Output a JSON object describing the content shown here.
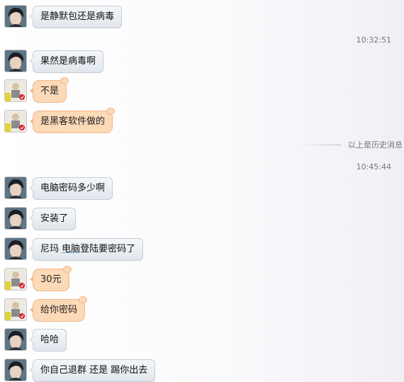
{
  "messages_before": [
    {
      "text": "是静默包还是病毒",
      "sender": "friend"
    }
  ],
  "time_1": "10:32:51",
  "block_1": [
    {
      "text": "果然是病毒啊",
      "sender": "friend"
    },
    {
      "text": "不是",
      "sender": "me"
    },
    {
      "text": "是黑客软件做的",
      "sender": "me"
    }
  ],
  "history_label": "以上是历史消息",
  "time_2": "10:45:44",
  "block_2": [
    {
      "text": "电脑密码多少啊",
      "sender": "friend"
    },
    {
      "text": "安装了",
      "sender": "friend"
    },
    {
      "text_a": "尼玛 ",
      "text_b": "电脑",
      "text_c": "登陆要密码了",
      "sender": "friend"
    },
    {
      "text": "30元",
      "sender": "me"
    },
    {
      "text": "给你密码",
      "sender": "me"
    },
    {
      "text": "哈哈",
      "sender": "friend"
    },
    {
      "text": "你自己退群 还是 踢你出去",
      "sender": "friend"
    }
  ],
  "colors": {
    "friend_bubble": "#e6eaef",
    "me_bubble": "#fcd9b7",
    "timestamp": "#777777"
  },
  "icons": {
    "friend_avatar": "avatar-dark-hair-icon",
    "me_avatar": "avatar-cartoon-figure-icon"
  }
}
